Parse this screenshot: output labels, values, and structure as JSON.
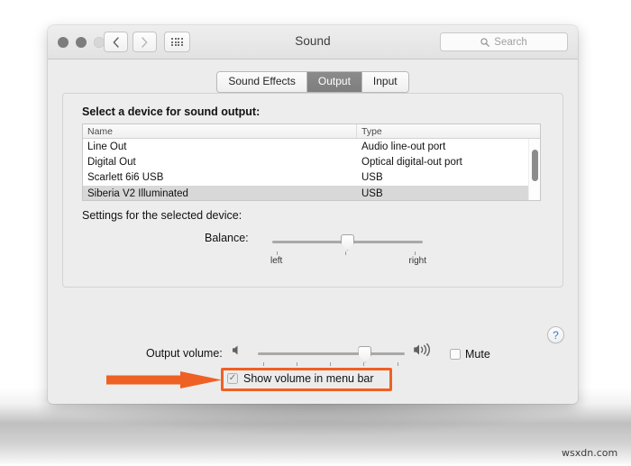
{
  "window": {
    "title": "Sound",
    "traffic_lights": [
      "close",
      "minimize",
      "zoom"
    ],
    "search": {
      "placeholder": "Search",
      "value": "",
      "icon": "search-icon"
    },
    "nav": {
      "back": "back-icon",
      "forward": "forward-icon",
      "grid": "show-all-icon"
    }
  },
  "tabs": [
    {
      "label": "Sound Effects",
      "active": false
    },
    {
      "label": "Output",
      "active": true
    },
    {
      "label": "Input",
      "active": false
    }
  ],
  "panel": {
    "heading": "Select a device for sound output:",
    "settings_heading": "Settings for the selected device:"
  },
  "table": {
    "columns": [
      "Name",
      "Type"
    ],
    "rows": [
      {
        "name": "Line Out",
        "type": "Audio line-out port",
        "selected": false
      },
      {
        "name": "Digital Out",
        "type": "Optical digital-out port",
        "selected": false
      },
      {
        "name": "Scarlett 6i6 USB",
        "type": "USB",
        "selected": false
      },
      {
        "name": "Siberia V2 Illuminated",
        "type": "USB",
        "selected": true
      }
    ]
  },
  "balance": {
    "label": "Balance:",
    "left_label": "left",
    "right_label": "right",
    "value_percent": 50
  },
  "help": {
    "glyph": "?",
    "name": "help-button"
  },
  "output_volume": {
    "label": "Output volume:",
    "value_percent": 73,
    "low_icon": "speaker-low-icon",
    "high_icon": "speaker-high-icon"
  },
  "mute": {
    "label": "Mute",
    "checked": false
  },
  "show_volume": {
    "label": "Show volume in menu bar",
    "checked": true,
    "check_glyph": "✓"
  },
  "annotation": {
    "arrow_color": "#ef6024",
    "highlight_color": "#ef6024",
    "target": "Show volume in menu bar"
  },
  "watermark": {
    "text": "wsxdn.com"
  }
}
